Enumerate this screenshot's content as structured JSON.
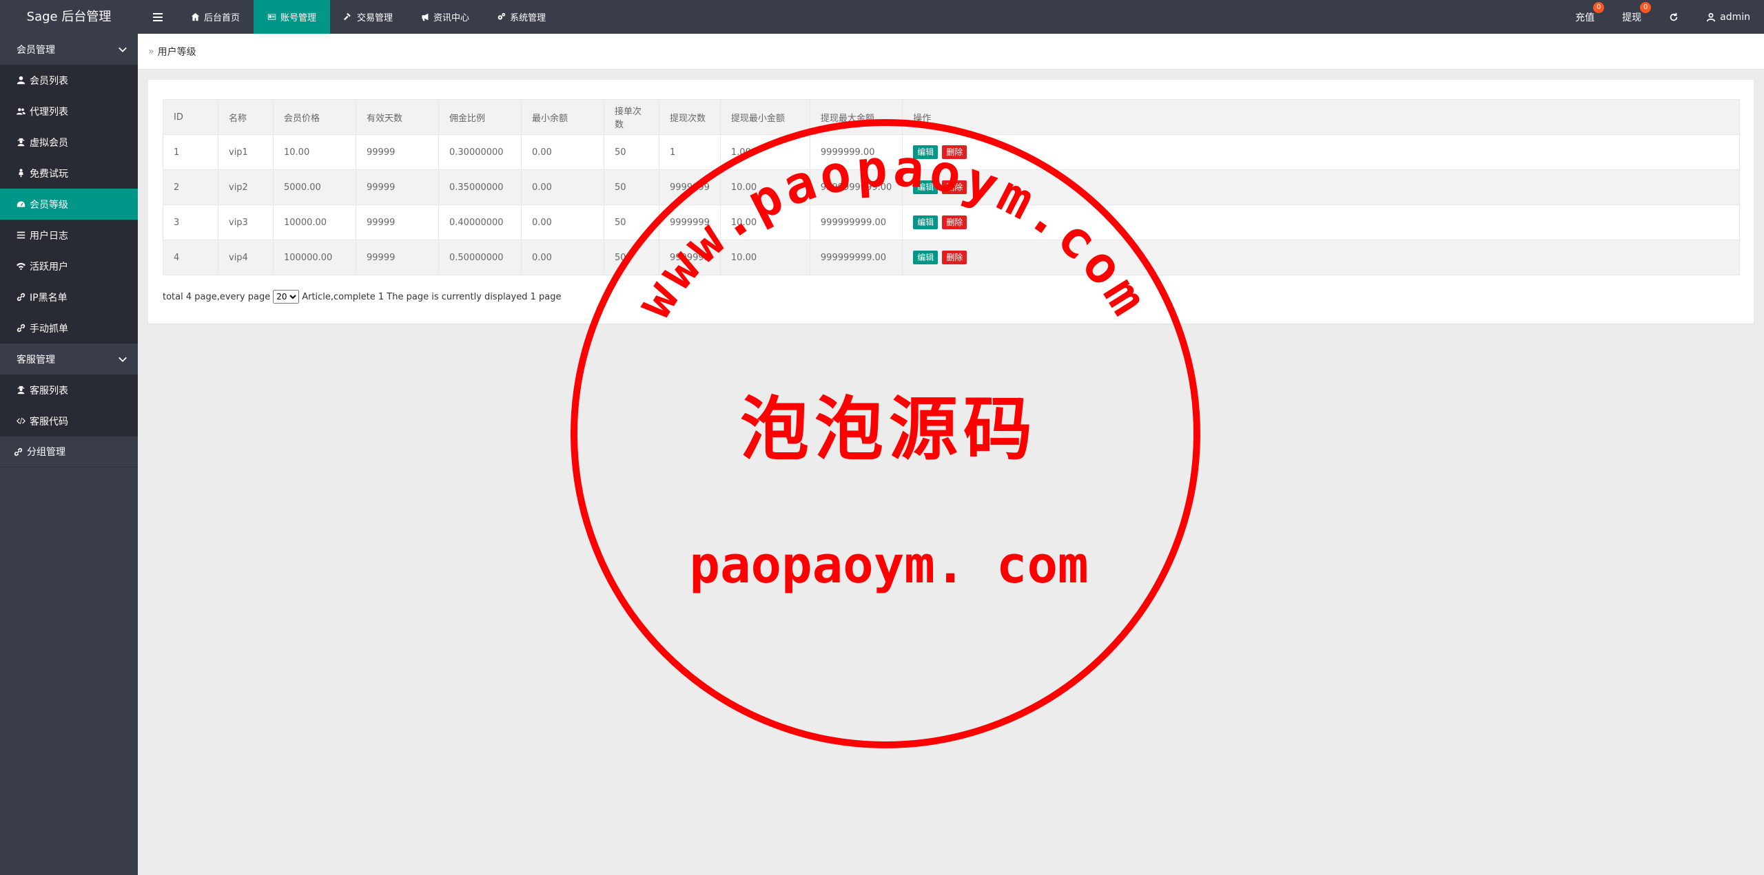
{
  "app": {
    "logo": "Sage 后台管理"
  },
  "topnav": [
    {
      "label": "后台首页",
      "icon": "home-icon",
      "active": false
    },
    {
      "label": "账号管理",
      "icon": "id-card-icon",
      "active": true
    },
    {
      "label": "交易管理",
      "icon": "gavel-icon",
      "active": false
    },
    {
      "label": "资讯中心",
      "icon": "bullhorn-icon",
      "active": false
    },
    {
      "label": "系统管理",
      "icon": "cogs-icon",
      "active": false
    }
  ],
  "topright": {
    "recharge": {
      "label": "充值",
      "badge": "0"
    },
    "withdraw": {
      "label": "提现",
      "badge": "0"
    },
    "refresh_icon": "refresh-icon",
    "user": {
      "label": "admin",
      "icon": "user-icon"
    }
  },
  "sidebar": {
    "group1": {
      "label": "会员管理"
    },
    "group1_items": [
      {
        "label": "会员列表",
        "icon": "user-icon"
      },
      {
        "label": "代理列表",
        "icon": "users-icon"
      },
      {
        "label": "虚拟会员",
        "icon": "user-secret-icon"
      },
      {
        "label": "免费试玩",
        "icon": "female-icon"
      },
      {
        "label": "会员等级",
        "icon": "tachometer-icon",
        "active": true
      },
      {
        "label": "用户日志",
        "icon": "list-icon"
      },
      {
        "label": "活跃用户",
        "icon": "wifi-icon"
      },
      {
        "label": "IP黑名单",
        "icon": "link-icon"
      },
      {
        "label": "手动抓单",
        "icon": "link-icon"
      }
    ],
    "group2": {
      "label": "客服管理"
    },
    "group2_items": [
      {
        "label": "客服列表",
        "icon": "user-secret-icon"
      },
      {
        "label": "客服代码",
        "icon": "code-icon"
      }
    ],
    "group3": {
      "label": "分组管理",
      "icon": "link-icon"
    }
  },
  "breadcrumb": {
    "current": "用户等级"
  },
  "table": {
    "headers": [
      "ID",
      "名称",
      "会员价格",
      "有效天数",
      "佣金比例",
      "最小余额",
      "接单次数",
      "提现次数",
      "提现最小金额",
      "提现最大金额",
      "操作"
    ],
    "rows": [
      [
        "1",
        "vip1",
        "10.00",
        "99999",
        "0.30000000",
        "0.00",
        "50",
        "1",
        "1.00",
        "9999999.00"
      ],
      [
        "2",
        "vip2",
        "5000.00",
        "99999",
        "0.35000000",
        "0.00",
        "50",
        "9999999",
        "10.00",
        "9999999999.00"
      ],
      [
        "3",
        "vip3",
        "10000.00",
        "99999",
        "0.40000000",
        "0.00",
        "50",
        "9999999",
        "10.00",
        "999999999.00"
      ],
      [
        "4",
        "vip4",
        "100000.00",
        "99999",
        "0.50000000",
        "0.00",
        "50",
        "9999999",
        "10.00",
        "999999999.00"
      ]
    ],
    "edit_label": "编辑",
    "delete_label": "删除"
  },
  "pager": {
    "prefix": "total 4 page,every page",
    "page_size": "20",
    "suffix": "Article,complete 1 The page is currently displayed 1 page"
  },
  "watermark": {
    "top_arc": "www.paopaoym.com",
    "middle": "泡泡源码",
    "bottom": "paopaoym. com",
    "color": "#ff0000"
  },
  "colors": {
    "accent": "#009688",
    "header": "#393d49",
    "sidebar_sub": "#282b33",
    "danger": "#e02020",
    "badge": "#ff5722"
  }
}
